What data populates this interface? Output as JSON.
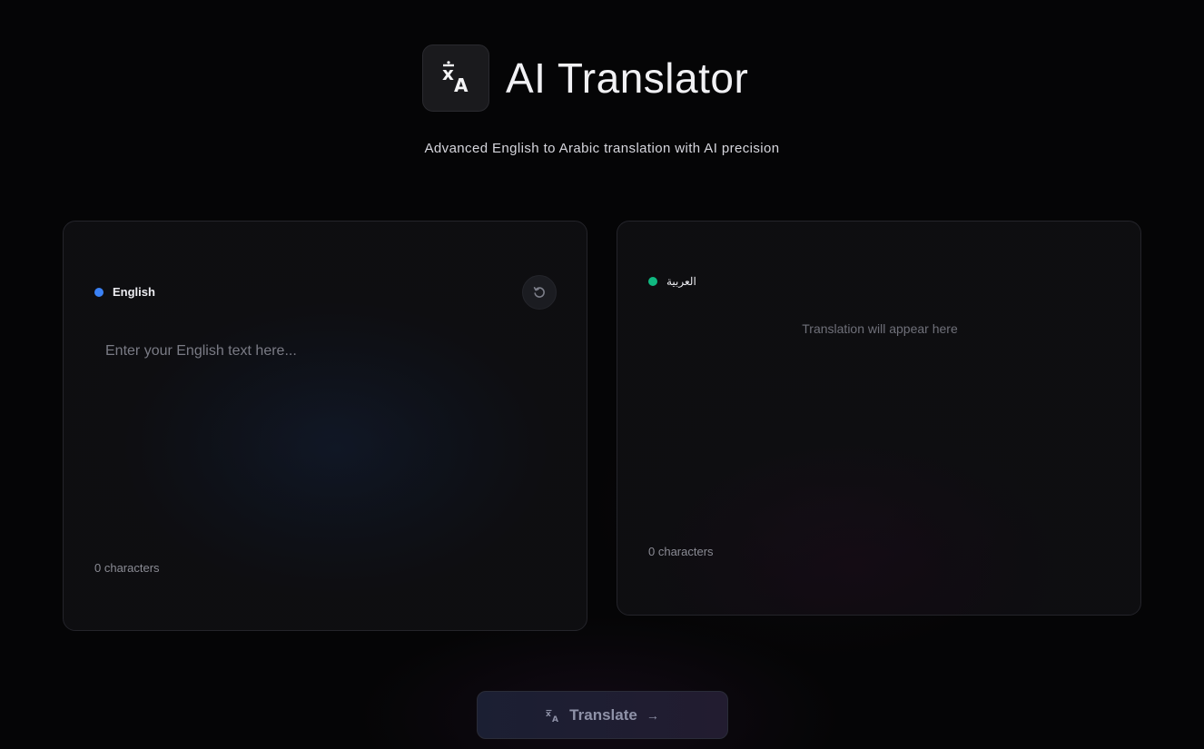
{
  "header": {
    "title": "AI Translator",
    "subtitle": "Advanced English to Arabic translation with AI precision",
    "logo_icon": "translate-icon"
  },
  "source_panel": {
    "language": "English",
    "dot_color": "#3b82f6",
    "input_placeholder": "Enter your English text here...",
    "input_value": "",
    "char_count": "0 characters",
    "reset_icon": "reset-icon"
  },
  "target_panel": {
    "language": "العربية",
    "dot_color": "#10b981",
    "output_placeholder": "Translation will appear here",
    "char_count": "0 characters"
  },
  "action": {
    "translate_label": "Translate",
    "translate_icon": "translate-icon",
    "arrow_icon": "arrow-right-icon"
  }
}
